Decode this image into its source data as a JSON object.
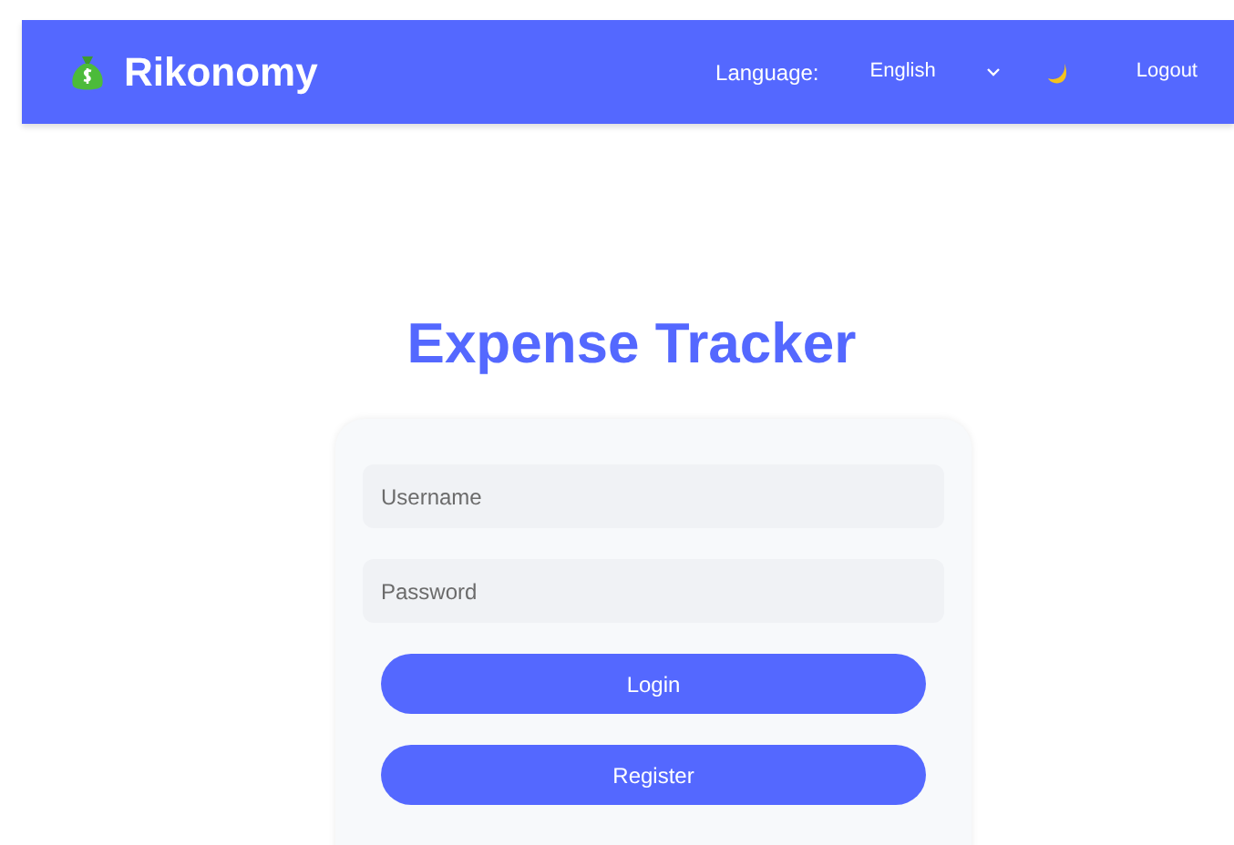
{
  "header": {
    "brand": "Rikonomy",
    "language_label": "Language:",
    "language_value": "English",
    "logout": "Logout"
  },
  "title": "Expense Tracker",
  "form": {
    "username": {
      "placeholder": "Username"
    },
    "password": {
      "placeholder": "Password"
    },
    "buttons": [
      "Login",
      "Register"
    ]
  }
}
